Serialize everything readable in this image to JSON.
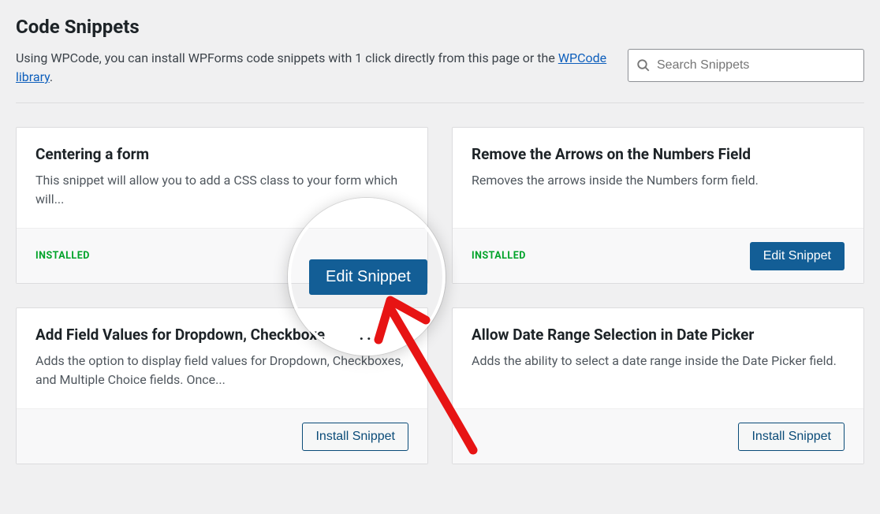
{
  "page": {
    "title": "Code Snippets",
    "subtitle_prefix": "Using WPCode, you can install WPForms code snippets with 1 click directly from this page or the ",
    "subtitle_link": "WPCode library",
    "subtitle_suffix": "."
  },
  "search": {
    "placeholder": "Search Snippets"
  },
  "status": {
    "installed": "INSTALLED"
  },
  "buttons": {
    "edit": "Edit Snippet",
    "install": "Install Snippet"
  },
  "snippets": [
    {
      "title": "Centering a form",
      "desc": "This snippet will allow you to add a CSS class to your form which will...",
      "installed": true
    },
    {
      "title": "Remove the Arrows on the Numbers Field",
      "desc": "Removes the arrows inside the Numbers form field.",
      "installed": true
    },
    {
      "title": "Add Field Values for Dropdown, Checkboxe",
      "desc": "Adds the option to display field values for Dropdown, Checkboxes, and Multiple Choice fields. Once...",
      "installed": false
    },
    {
      "title": "Allow Date Range Selection in Date Picker",
      "desc": "Adds the ability to select a date range inside the Date Picker field.",
      "installed": false
    }
  ]
}
